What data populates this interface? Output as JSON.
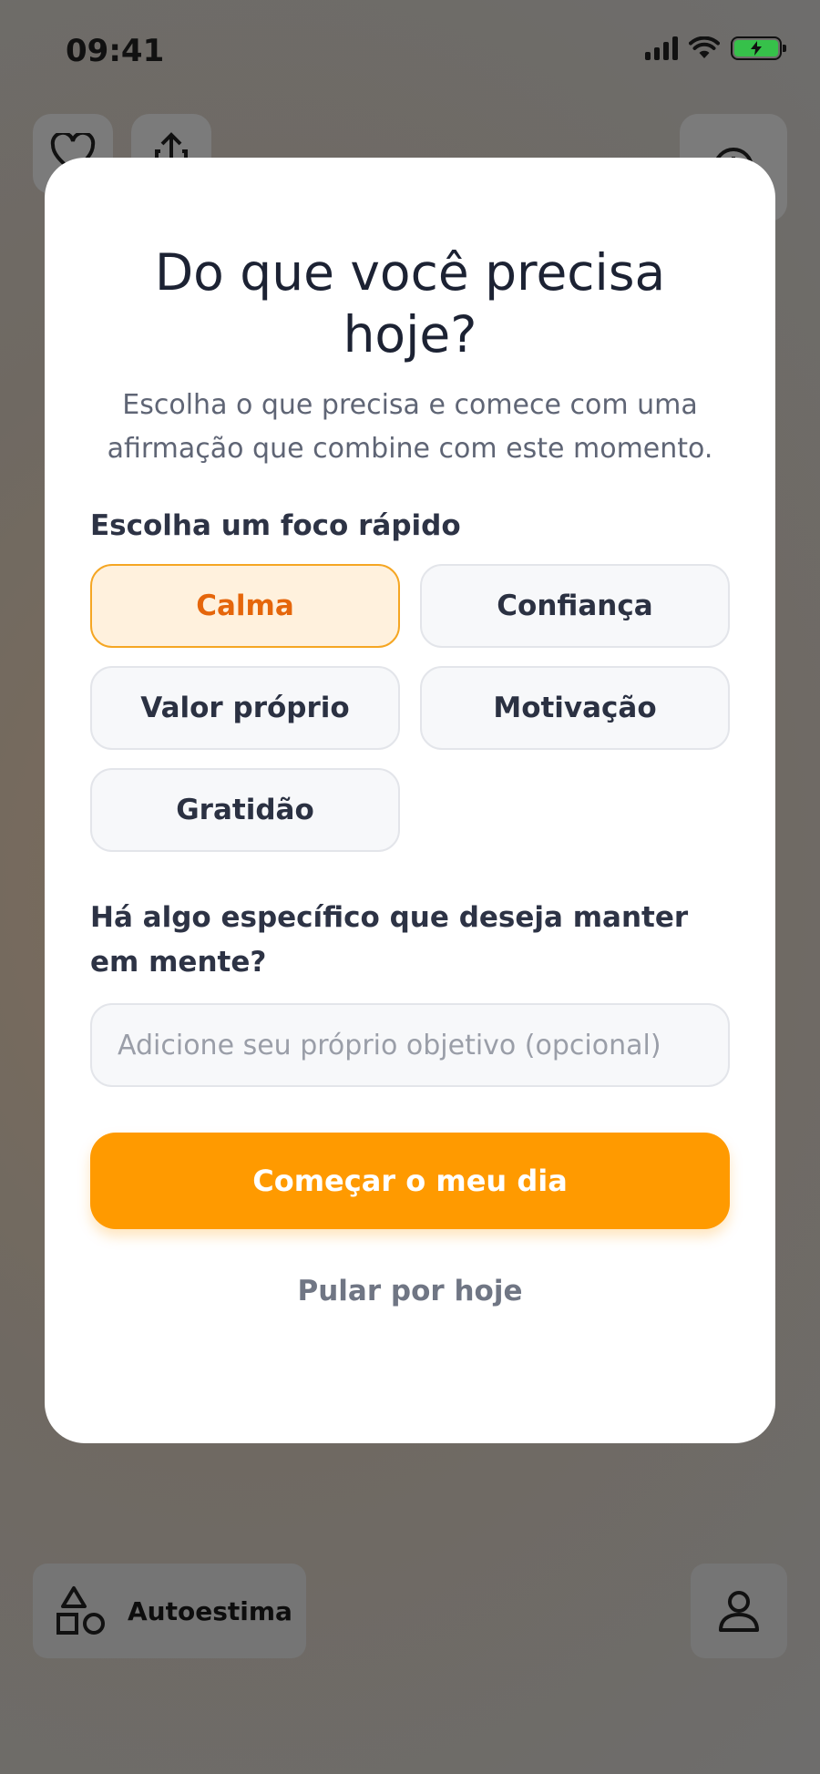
{
  "status_bar": {
    "time": "09:41"
  },
  "modal": {
    "title": "Do que você precisa hoje?",
    "subtitle": "Escolha o que precisa e comece com uma afirmação que combine com este momento.",
    "focus_label": "Escolha um foco rápido",
    "chips": [
      {
        "label": "Calma",
        "selected": true
      },
      {
        "label": "Confiança",
        "selected": false
      },
      {
        "label": "Valor próprio",
        "selected": false
      },
      {
        "label": "Motivação",
        "selected": false
      },
      {
        "label": "Gratidão",
        "selected": false
      }
    ],
    "goal_label": "Há algo específico que deseja manter em mente?",
    "goal_input": {
      "value": "",
      "placeholder": "Adicione seu próprio objetivo (opcional)"
    },
    "start_button": "Começar o meu dia",
    "skip_link": "Pular por hoje"
  },
  "background": {
    "category_label": "Autoestima"
  },
  "colors": {
    "accent": "#ff9a00",
    "selected_chip_bg": "#fff1dd",
    "selected_chip_text": "#e5660b",
    "battery": "#36c14a"
  }
}
